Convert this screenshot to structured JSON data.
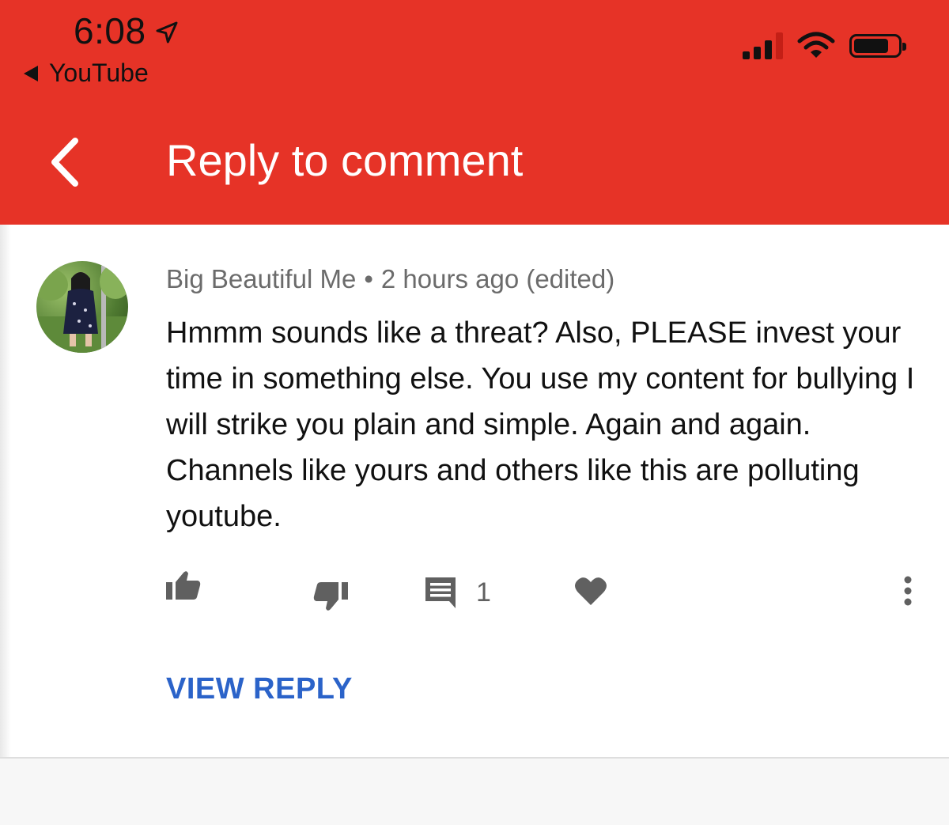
{
  "status_bar": {
    "time": "6:08",
    "back_app": "YouTube"
  },
  "header": {
    "title": "Reply to comment",
    "background_color": "#e63327"
  },
  "comment": {
    "author": "Big Beautiful Me",
    "separator": "•",
    "timestamp": "2 hours ago (edited)",
    "body": "Hmmm sounds like a threat? Also, PLEASE invest your time in something else. You use my content for bullying I will strike you plain and simple. Again and again. Channels like yours and others like this are polluting youtube."
  },
  "actions": {
    "reply_count": "1"
  },
  "view_reply_label": "VIEW REPLY",
  "colors": {
    "accent_red": "#e63327",
    "link_blue": "#2b63c9",
    "icon_gray": "#606060"
  }
}
